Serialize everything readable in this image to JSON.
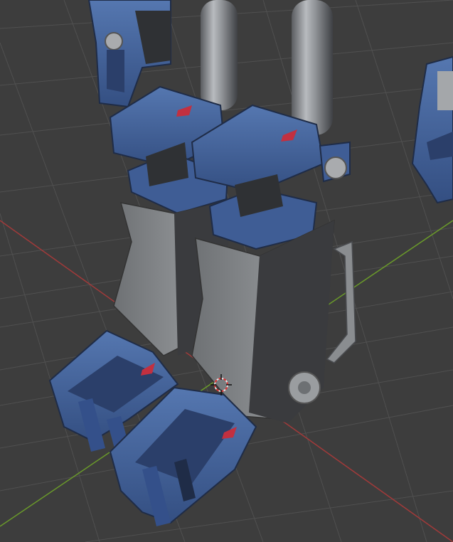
{
  "viewport": {
    "background": "#3d3d3d",
    "grid_color": "#505050",
    "x_axis_color": "#a23a3a",
    "y_axis_color": "#6a9a2a"
  },
  "model": {
    "armor_color": "#3f5d95",
    "armor_dark": "#2b3f6a",
    "metal_color": "#8a8d90",
    "metal_dark": "#5d6064",
    "body_dark": "#3a3b3e",
    "accent_red": "#c23040"
  },
  "icons": {
    "cursor": "3d-cursor-icon"
  }
}
